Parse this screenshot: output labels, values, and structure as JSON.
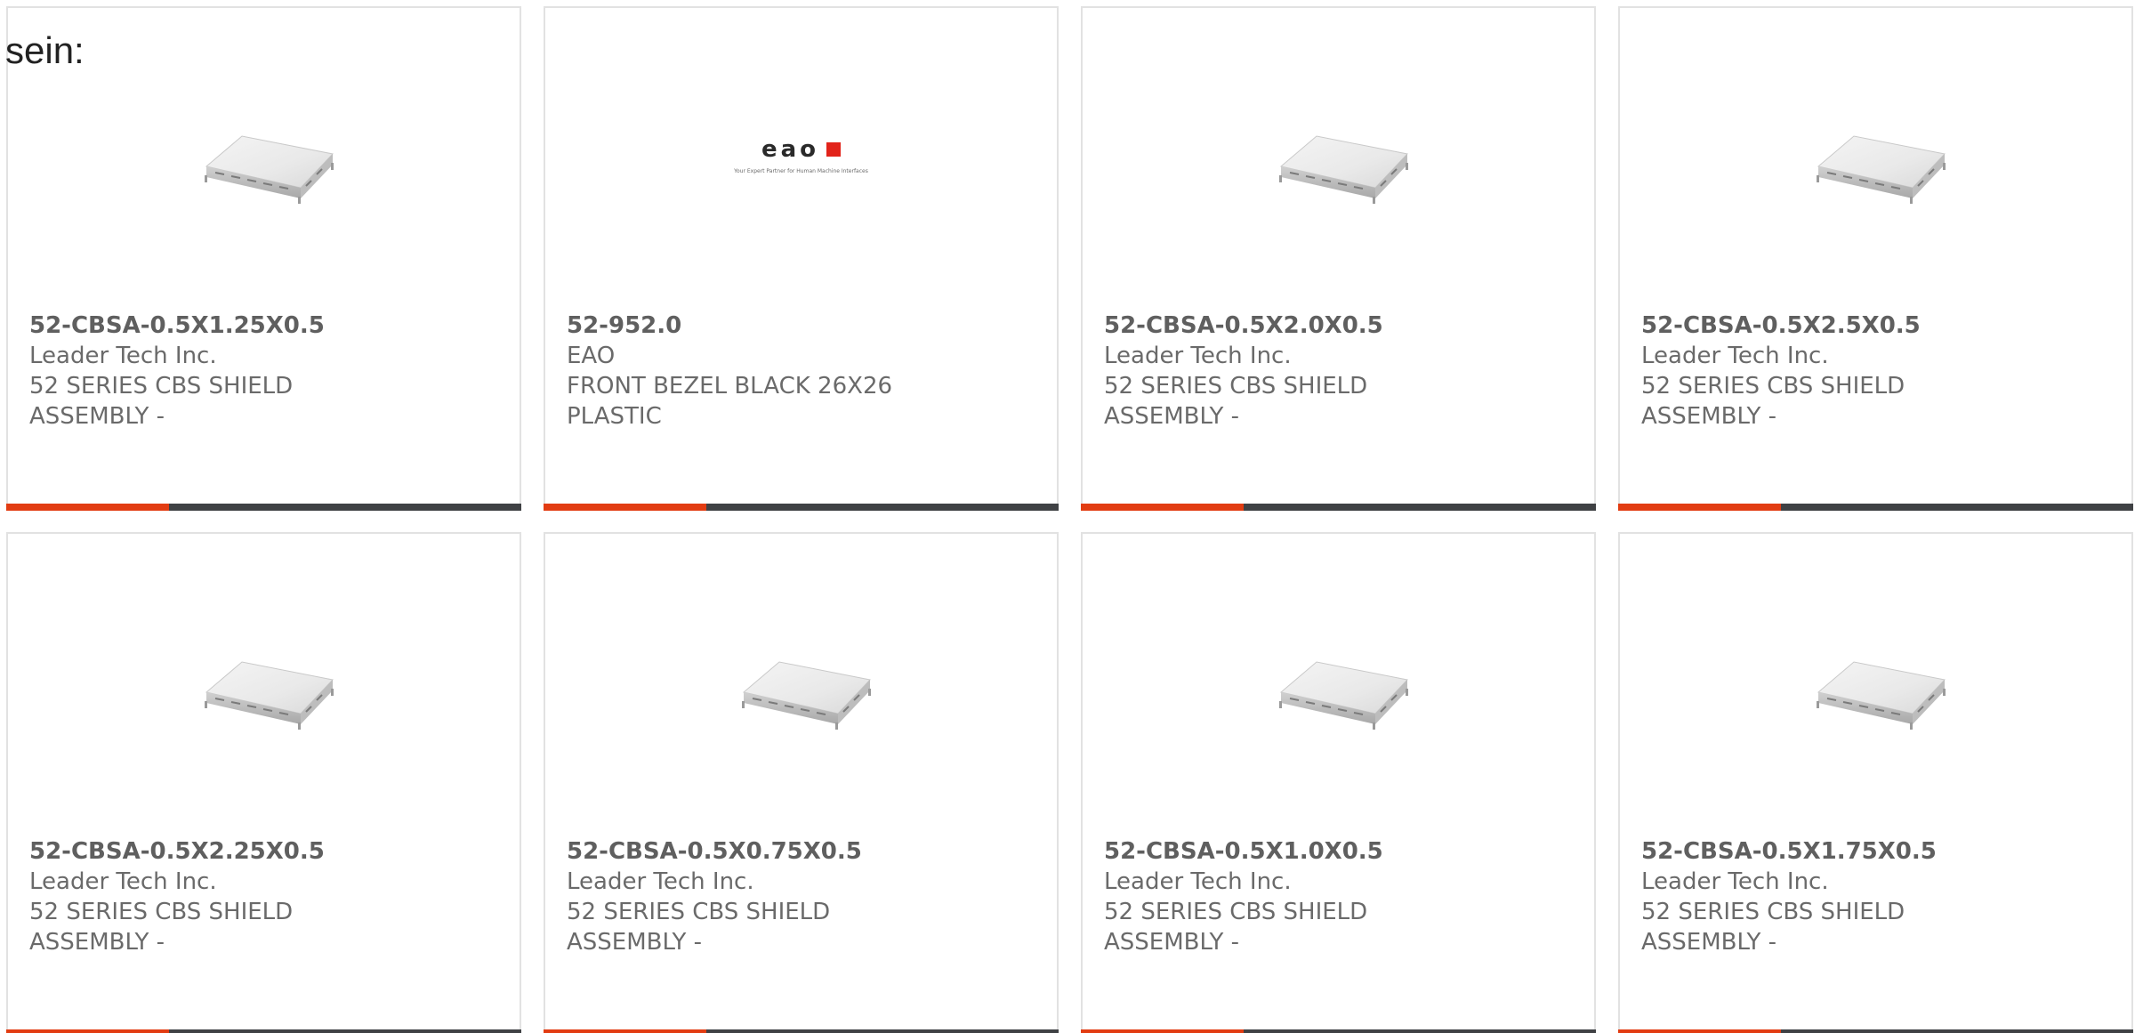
{
  "intro_text": "sein:",
  "colors": {
    "accent_bar": "#e23c12",
    "dark_bar": "#3f4144",
    "card_border": "#e2e2e2",
    "text": "#6a6a6a",
    "eao_red": "#e2231a"
  },
  "eao_logo": {
    "wordmark": "eao",
    "tagline": "Your Expert Partner for Human Machine Interfaces"
  },
  "products": [
    {
      "part_number": "52-CBSA-0.5X1.25X0.5",
      "manufacturer": "Leader Tech Inc.",
      "description": "52 SERIES CBS SHIELD ASSEMBLY -",
      "image": "shield-image"
    },
    {
      "part_number": "52-952.0",
      "manufacturer": "EAO",
      "description": "FRONT BEZEL BLACK 26X26 PLASTIC",
      "image": "eao-logo"
    },
    {
      "part_number": "52-CBSA-0.5X2.0X0.5",
      "manufacturer": "Leader Tech Inc.",
      "description": "52 SERIES CBS SHIELD ASSEMBLY -",
      "image": "shield-image"
    },
    {
      "part_number": "52-CBSA-0.5X2.5X0.5",
      "manufacturer": "Leader Tech Inc.",
      "description": "52 SERIES CBS SHIELD ASSEMBLY -",
      "image": "shield-image"
    },
    {
      "part_number": "52-CBSA-0.5X2.25X0.5",
      "manufacturer": "Leader Tech Inc.",
      "description": "52 SERIES CBS SHIELD ASSEMBLY -",
      "image": "shield-image"
    },
    {
      "part_number": "52-CBSA-0.5X0.75X0.5",
      "manufacturer": "Leader Tech Inc.",
      "description": "52 SERIES CBS SHIELD ASSEMBLY -",
      "image": "shield-image"
    },
    {
      "part_number": "52-CBSA-0.5X1.0X0.5",
      "manufacturer": "Leader Tech Inc.",
      "description": "52 SERIES CBS SHIELD ASSEMBLY -",
      "image": "shield-image"
    },
    {
      "part_number": "52-CBSA-0.5X1.75X0.5",
      "manufacturer": "Leader Tech Inc.",
      "description": "52 SERIES CBS SHIELD ASSEMBLY -",
      "image": "shield-image"
    }
  ]
}
